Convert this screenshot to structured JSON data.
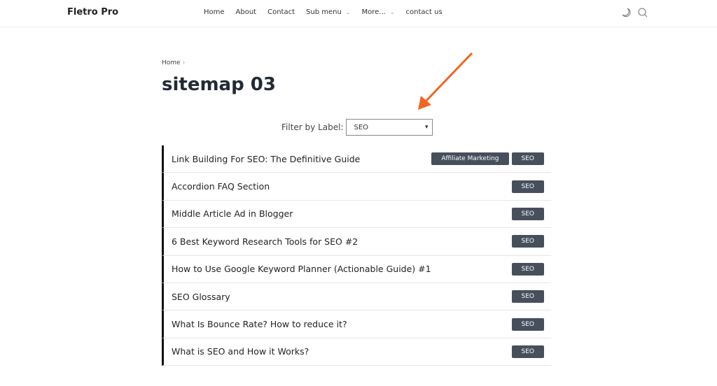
{
  "header": {
    "brand": "Fletro Pro",
    "nav": [
      "Home",
      "About",
      "Contact",
      "Sub menu",
      "More...",
      "contact us"
    ],
    "icons": [
      "moon-icon",
      "search-icon"
    ]
  },
  "breadcrumb": {
    "home": "Home",
    "separator": "›"
  },
  "page_title": "sitemap 03",
  "filter": {
    "label": "Filter by Label:",
    "selected": "SEO"
  },
  "annotation": {
    "arrow_color": "#f26522"
  },
  "posts": [
    {
      "title": "Link Building For SEO: The Definitive Guide",
      "labels": [
        "Affiliate Marketing",
        "SEO"
      ]
    },
    {
      "title": "Accordion FAQ Section",
      "labels": [
        "SEO"
      ]
    },
    {
      "title": "Middle Article Ad in Blogger",
      "labels": [
        "SEO"
      ]
    },
    {
      "title": "6 Best Keyword Research Tools for SEO #2",
      "labels": [
        "SEO"
      ]
    },
    {
      "title": "How to Use Google Keyword Planner (Actionable Guide) #1",
      "labels": [
        "SEO"
      ]
    },
    {
      "title": "SEO Glossary",
      "labels": [
        "SEO"
      ]
    },
    {
      "title": "What Is Bounce Rate? How to reduce it?",
      "labels": [
        "SEO"
      ]
    },
    {
      "title": "What is SEO and How it Works?",
      "labels": [
        "SEO"
      ]
    }
  ]
}
